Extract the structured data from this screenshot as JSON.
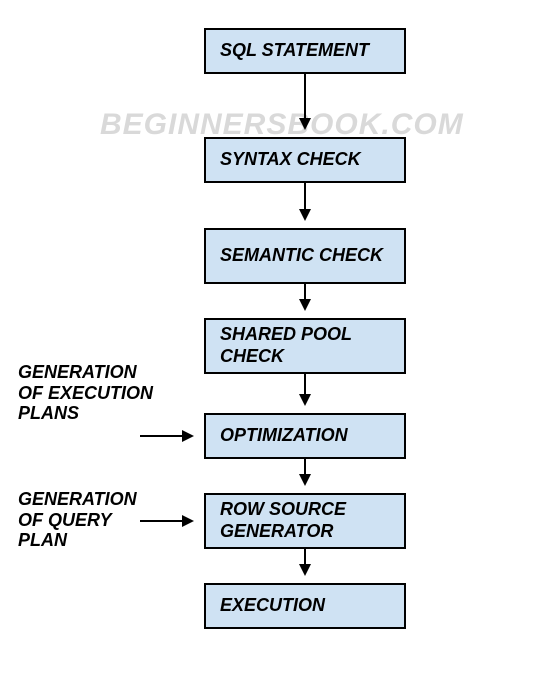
{
  "watermark": "BEGINNERSBOOK.COM",
  "nodes": {
    "n1": "SQL STATEMENT",
    "n2": "SYNTAX CHECK",
    "n3": "SEMANTIC CHECK",
    "n4": "SHARED POOL CHECK",
    "n5": "OPTIMIZATION",
    "n6": "ROW SOURCE GENERATOR",
    "n7": "EXECUTION"
  },
  "side_labels": {
    "s1": "GENERATION OF EXECUTION PLANS",
    "s2": "GENERATION OF QUERY PLAN"
  },
  "chart_data": {
    "type": "flowchart",
    "direction": "top-down",
    "nodes": [
      {
        "id": "n1",
        "label": "SQL STATEMENT"
      },
      {
        "id": "n2",
        "label": "SYNTAX CHECK"
      },
      {
        "id": "n3",
        "label": "SEMANTIC CHECK"
      },
      {
        "id": "n4",
        "label": "SHARED POOL CHECK"
      },
      {
        "id": "n5",
        "label": "OPTIMIZATION",
        "annotation": "GENERATION OF EXECUTION PLANS"
      },
      {
        "id": "n6",
        "label": "ROW SOURCE GENERATOR",
        "annotation": "GENERATION OF QUERY PLAN"
      },
      {
        "id": "n7",
        "label": "EXECUTION"
      }
    ],
    "edges": [
      {
        "from": "n1",
        "to": "n2"
      },
      {
        "from": "n2",
        "to": "n3"
      },
      {
        "from": "n3",
        "to": "n4"
      },
      {
        "from": "n4",
        "to": "n5"
      },
      {
        "from": "n5",
        "to": "n6"
      },
      {
        "from": "n6",
        "to": "n7"
      }
    ]
  }
}
